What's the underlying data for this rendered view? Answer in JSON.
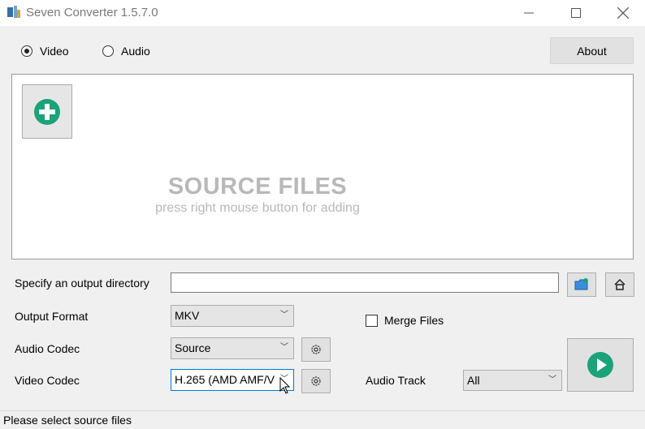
{
  "window": {
    "title": "Seven Converter 1.5.7.0"
  },
  "mode": {
    "video_label": "Video",
    "audio_label": "Audio",
    "selected": "Video"
  },
  "about_label": "About",
  "source": {
    "title": "SOURCE FILES",
    "hint": "press right mouse button for adding"
  },
  "output_dir": {
    "label": "Specify an output directory",
    "value": ""
  },
  "output_format": {
    "label": "Output Format",
    "value": "MKV"
  },
  "merge_files": {
    "label": "Merge Files",
    "checked": false
  },
  "audio_codec": {
    "label": "Audio Codec",
    "value": "Source"
  },
  "video_codec": {
    "label": "Video Codec",
    "value": "H.265 (AMD AMF/V"
  },
  "audio_track": {
    "label": "Audio Track",
    "value": "All"
  },
  "status": {
    "text": "Please select source files"
  },
  "colors": {
    "accent_green": "#1aa37a",
    "source_text": "#b8b8b8"
  },
  "icons": [
    "app-icon",
    "minimize-icon",
    "maximize-icon",
    "close-icon",
    "add-icon",
    "folder-icon",
    "home-icon",
    "gear-icon",
    "play-icon",
    "chevron-down-icon",
    "cursor-icon"
  ]
}
